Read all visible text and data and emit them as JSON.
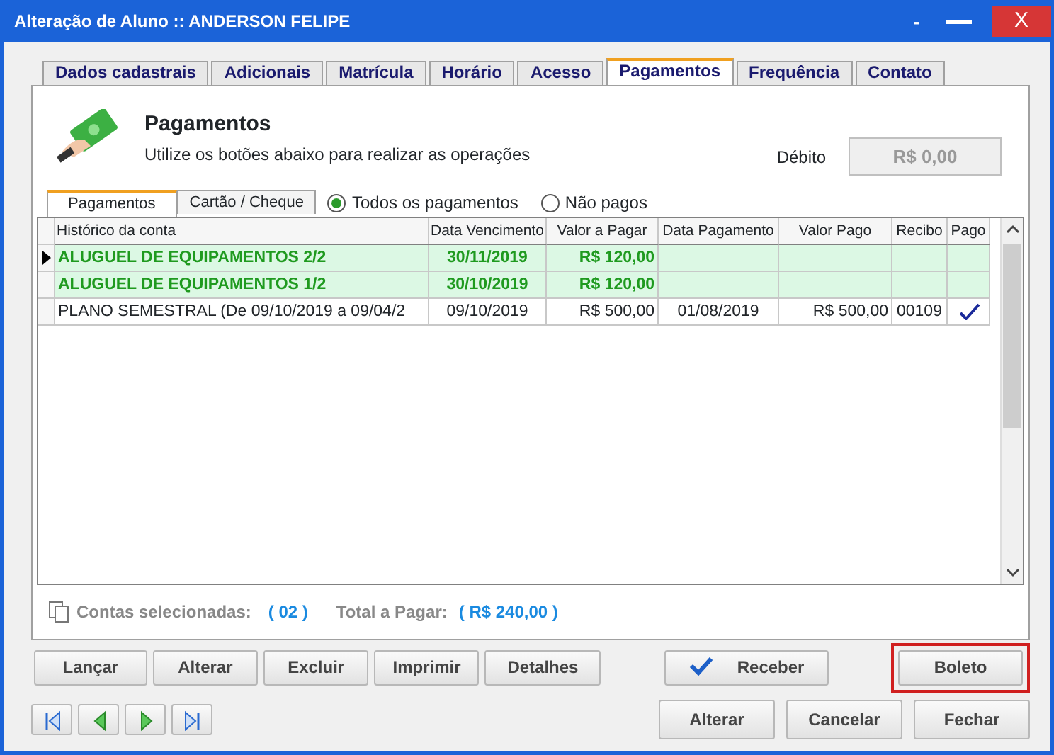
{
  "window": {
    "title": "Alteração de Aluno :: ANDERSON FELIPE",
    "controls": [
      "-",
      "X"
    ]
  },
  "tabs": [
    {
      "label": "Dados cadastrais",
      "selected": false
    },
    {
      "label": "Adicionais",
      "selected": false
    },
    {
      "label": "Matrícula",
      "selected": false
    },
    {
      "label": "Horário",
      "selected": false
    },
    {
      "label": "Acesso",
      "selected": false
    },
    {
      "label": "Pagamentos",
      "selected": true
    },
    {
      "label": "Frequência",
      "selected": false
    },
    {
      "label": "Contato",
      "selected": false
    }
  ],
  "header": {
    "title": "Pagamentos",
    "subtitle": "Utilize os botões abaixo para realizar as operações"
  },
  "debit": {
    "label": "Débito",
    "value": "R$ 0,00"
  },
  "subtabs": [
    {
      "label": "Pagamentos",
      "selected": true
    },
    {
      "label": "Cartão / Cheque",
      "selected": false
    }
  ],
  "filter": [
    {
      "label": "Todos os pagamentos",
      "selected": true
    },
    {
      "label": "Não pagos",
      "selected": false
    }
  ],
  "table": {
    "columns": [
      "Histórico da conta",
      "Data Vencimento",
      "Valor a Pagar",
      "Data Pagamento",
      "Valor Pago",
      "Recibo",
      "Pago"
    ],
    "rows": [
      {
        "current": true,
        "selected": true,
        "paid": false,
        "cells": [
          "ALUGUEL DE EQUIPAMENTOS 2/2",
          "30/11/2019",
          "R$ 120,00",
          "",
          "",
          "",
          ""
        ]
      },
      {
        "current": false,
        "selected": true,
        "paid": false,
        "cells": [
          "ALUGUEL DE EQUIPAMENTOS 1/2",
          "30/10/2019",
          "R$ 120,00",
          "",
          "",
          "",
          ""
        ]
      },
      {
        "current": false,
        "selected": false,
        "paid": true,
        "cells": [
          "PLANO SEMESTRAL (De 09/10/2019 a 09/04/2",
          "09/10/2019",
          "R$ 500,00",
          "01/08/2019",
          "R$ 500,00",
          "00109",
          ""
        ]
      }
    ]
  },
  "summary": {
    "selected_label": "Contas selecionadas:",
    "selected_value": "( 02 )",
    "total_label": "Total a Pagar:",
    "total_value": "( R$ 240,00 )"
  },
  "actions": [
    {
      "label": "Lançar",
      "kind": "plain",
      "highlighted": false
    },
    {
      "label": "Alterar",
      "kind": "plain",
      "highlighted": false
    },
    {
      "label": "Excluir",
      "kind": "plain",
      "highlighted": false
    },
    {
      "label": "Imprimir",
      "kind": "plain",
      "highlighted": false
    },
    {
      "label": "Detalhes",
      "kind": "plain",
      "highlighted": false
    },
    {
      "label": "Receber",
      "kind": "check",
      "highlighted": false
    },
    {
      "label": "Boleto",
      "kind": "plain",
      "highlighted": true
    }
  ],
  "footer_buttons": [
    "Alterar",
    "Cancelar",
    "Fechar"
  ]
}
